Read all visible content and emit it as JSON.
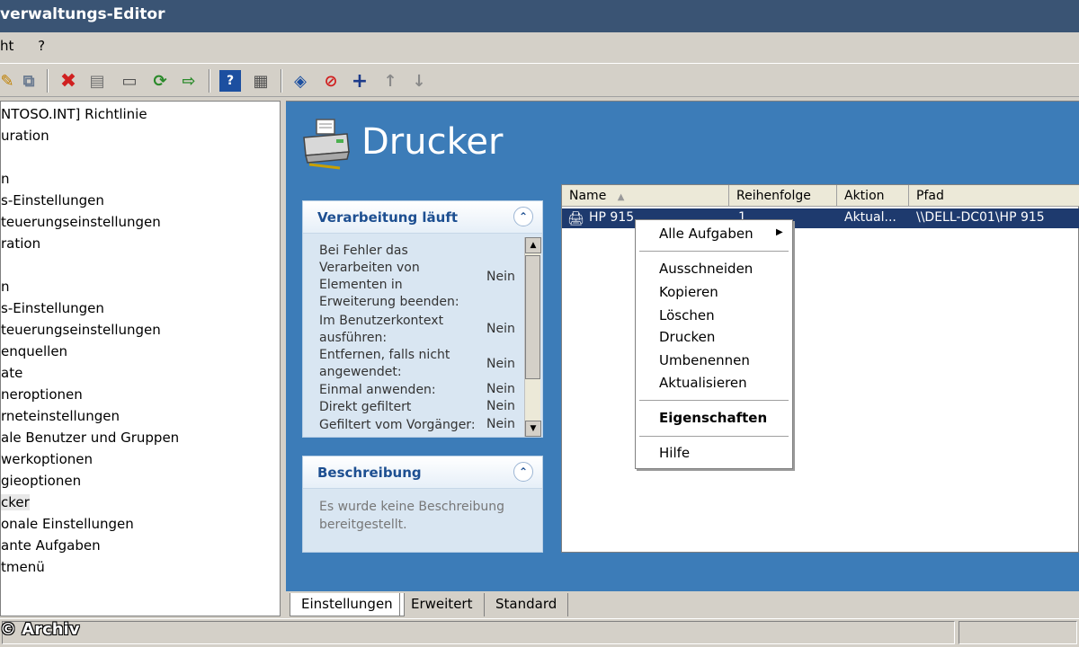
{
  "window": {
    "title": "verwaltungs-Editor"
  },
  "menu": {
    "items": [
      "ht",
      "?"
    ]
  },
  "tree": {
    "items": [
      "NTOSO.INT] Richtlinie",
      "uration",
      "",
      "n",
      "s-Einstellungen",
      "teuerungseinstellungen",
      "ration",
      "",
      "n",
      "s-Einstellungen",
      "teuerungseinstellungen",
      "enquellen",
      "ate",
      "neroptionen",
      "rneteinstellungen",
      "ale Benutzer und Gruppen",
      "werkoptionen",
      "gieoptionen",
      "cker",
      "onale Einstellungen",
      "ante Aufgaben",
      "tmenü"
    ],
    "selected_index": 18
  },
  "main": {
    "title": "Drucker"
  },
  "processing_panel": {
    "title": "Verarbeitung läuft",
    "rows": [
      {
        "label": [
          "Bei Fehler das",
          "Verarbeiten von",
          "Elementen in",
          "Erweiterung beenden:"
        ],
        "value": "Nein"
      },
      {
        "label": [
          "Im Benutzerkontext",
          "ausführen:"
        ],
        "value": "Nein"
      },
      {
        "label": [
          "Entfernen, falls nicht",
          "angewendet:"
        ],
        "value": "Nein"
      },
      {
        "label": [
          "Einmal anwenden:"
        ],
        "value": "Nein"
      },
      {
        "label": [
          "Direkt gefiltert"
        ],
        "value": "Nein"
      },
      {
        "label": [
          "Gefiltert vom Vorgänger:"
        ],
        "value": "Nein"
      }
    ]
  },
  "description_panel": {
    "title": "Beschreibung",
    "text_line1": "Es wurde keine Beschreibung",
    "text_line2": "bereitgestellt."
  },
  "list": {
    "columns": [
      "Name",
      "Reihenfolge",
      "Aktion",
      "Pfad"
    ],
    "rows": [
      {
        "name": "HP 915",
        "order": "1",
        "action": "Aktual...",
        "path": "\\\\DELL-DC01\\HP 915"
      }
    ]
  },
  "context_menu": {
    "all_tasks": "Alle Aufgaben",
    "cut": "Ausschneiden",
    "copy": "Kopieren",
    "delete": "Löschen",
    "print": "Drucken",
    "rename": "Umbenennen",
    "refresh": "Aktualisieren",
    "properties": "Eigenschaften",
    "help": "Hilfe"
  },
  "tabs": [
    "Einstellungen",
    "Erweitert",
    "Standard"
  ],
  "watermark": "© Archiv",
  "colors": {
    "title_bar": "#3a5474",
    "main_background": "#3c7cb8",
    "selection": "#1e3a6e",
    "panel_title": "#1d4f91"
  }
}
